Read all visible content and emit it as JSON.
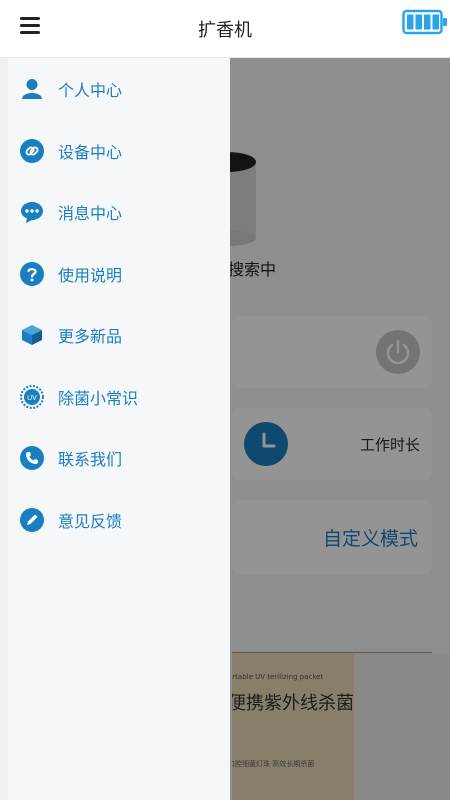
{
  "app": {
    "title": "扩香机"
  },
  "drawer": {
    "items": [
      {
        "label": "个人中心",
        "icon": "person-icon"
      },
      {
        "label": "设备中心",
        "icon": "link-icon"
      },
      {
        "label": "消息中心",
        "icon": "chat-icon"
      },
      {
        "label": "使用说明",
        "icon": "help-icon"
      },
      {
        "label": "更多新品",
        "icon": "box-icon"
      },
      {
        "label": "除菌小常识",
        "icon": "uv-icon"
      },
      {
        "label": "联系我们",
        "icon": "phone-icon"
      },
      {
        "label": "意见反馈",
        "icon": "pencil-icon"
      }
    ]
  },
  "main": {
    "status": "搜索中",
    "work_time_label": "工作时长",
    "custom_mode_label": "自定义模式",
    "banner": {
      "line1": "ortable UV terilizing packet",
      "line2": "便携紫外线杀菌包",
      "line3": "口腔细菌灯珠  高效长期杀菌"
    }
  },
  "colors": {
    "accent": "#1a7fc0",
    "battery": "#2aa6e8"
  }
}
